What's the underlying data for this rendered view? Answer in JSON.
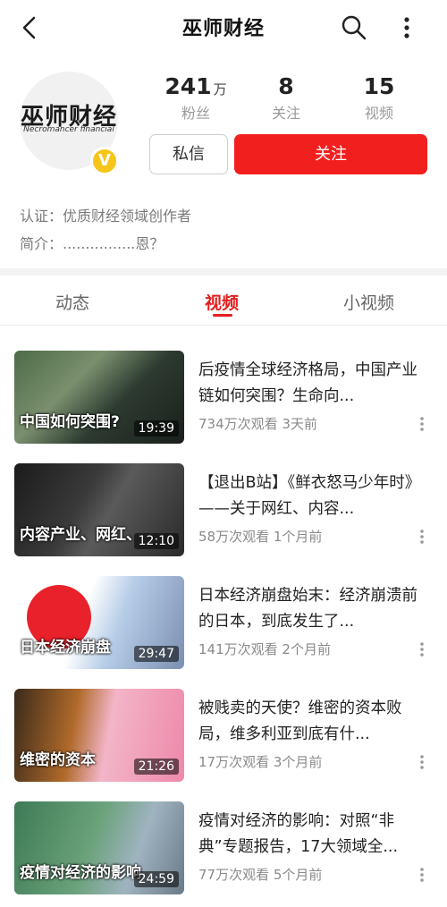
{
  "header": {
    "title": "巫师财经"
  },
  "profile": {
    "avatar_text": "巫师财经",
    "avatar_subtext": "Necromancer financial",
    "verified_badge": "V",
    "stats": [
      {
        "num": "241",
        "unit": "万",
        "label": "粉丝"
      },
      {
        "num": "8",
        "unit": "",
        "label": "关注"
      },
      {
        "num": "15",
        "unit": "",
        "label": "视频"
      }
    ],
    "message_button": "私信",
    "follow_button": "关注",
    "certification": "认证：优质财经领域创作者",
    "intro": "简介：................恩？"
  },
  "tabs": [
    {
      "label": "动态",
      "active": false
    },
    {
      "label": "视频",
      "active": true
    },
    {
      "label": "小视频",
      "active": false
    }
  ],
  "videos": [
    {
      "thumb_caption": "中国如何突围?",
      "duration": "19:39",
      "title": "后疫情全球经济格局，中国产业链如何突围？生命向...",
      "meta": "734万次观看  3天前"
    },
    {
      "thumb_caption": "内容产业、网红、",
      "duration": "12:10",
      "title": "【退出B站】《鲜衣怒马少年时》——关于网红、内容...",
      "meta": "58万次观看  1个月前"
    },
    {
      "thumb_caption": "日本经济崩盘",
      "duration": "29:47",
      "title": "日本经济崩盘始末：经济崩溃前的日本，到底发生了...",
      "meta": "141万次观看  2个月前"
    },
    {
      "thumb_caption": "维密的资本",
      "duration": "21:26",
      "title": "被贱卖的天使？维密的资本败局，维多利亚到底有什...",
      "meta": "17万次观看  3个月前"
    },
    {
      "thumb_caption": "疫情对经济的影响",
      "duration": "24:59",
      "title": "疫情对经济的影响：对照“非典”专题报告，17大领域全...",
      "meta": "77万次观看  5个月前"
    }
  ],
  "colors": {
    "accent": "#f21f1f",
    "verified": "#f5c518"
  }
}
